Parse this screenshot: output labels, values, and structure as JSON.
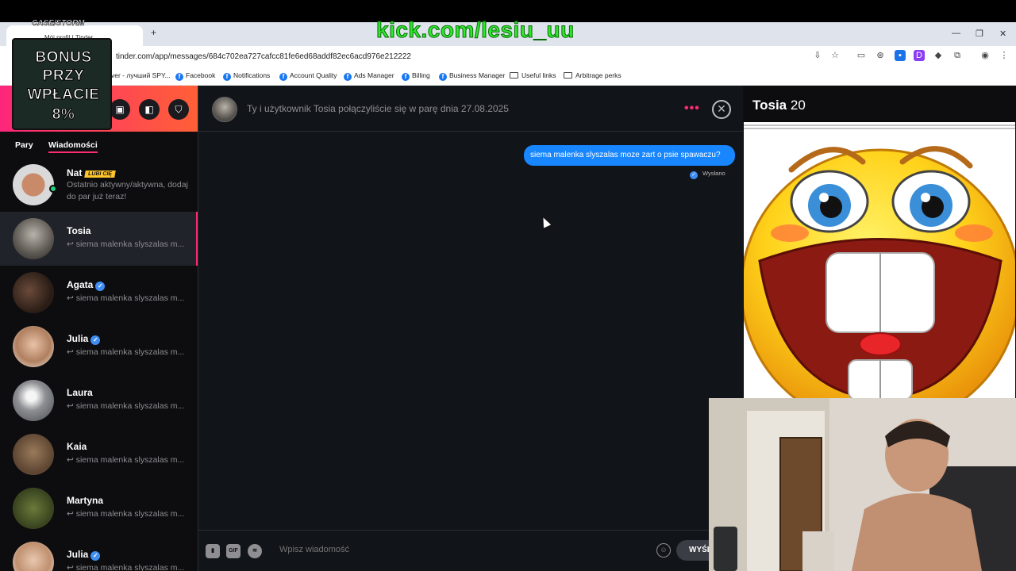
{
  "overlay": {
    "stream_url": "kick.com/lesiu_uu",
    "promo_logo": "CASE/STORM",
    "promo_line1": "BONUS",
    "promo_line2": "PRZY",
    "promo_line3": "WPŁACIE",
    "promo_line4": "8%"
  },
  "browser": {
    "tab_title": "Mój profil | Tinder",
    "new_tab": "+",
    "url": "tinder.com/app/messages/684c702ea727cafcc81fe6ed68addf82ec6acd976e212222",
    "bookmarks": [
      {
        "label": "ver - лучший SPY...",
        "icon": "none"
      },
      {
        "label": "Facebook",
        "icon": "facebook-icon"
      },
      {
        "label": "Notifications",
        "icon": "facebook-icon"
      },
      {
        "label": "Account Quality",
        "icon": "facebook-icon"
      },
      {
        "label": "Ads Manager",
        "icon": "facebook-icon"
      },
      {
        "label": "Billing",
        "icon": "facebook-icon"
      },
      {
        "label": "Business Manager",
        "icon": "facebook-icon"
      },
      {
        "label": "Useful links",
        "icon": "folder-icon"
      },
      {
        "label": "Arbitrage perks",
        "icon": "folder-icon"
      }
    ]
  },
  "sidebar": {
    "tabs": {
      "matches": "Pary",
      "messages": "Wiadomości"
    },
    "conversations": [
      {
        "name": "Nat",
        "badge": "LUBI CIĘ",
        "verified": false,
        "preview": "Ostatnio aktywny/aktywna, dodaj do par już teraz!",
        "online": true
      },
      {
        "name": "Tosia",
        "verified": false,
        "preview": "↩ siema malenka slyszalas m...",
        "selected": true
      },
      {
        "name": "Agata",
        "verified": true,
        "preview": "↩ siema malenka slyszalas m..."
      },
      {
        "name": "Julia",
        "verified": true,
        "preview": "↩ siema malenka slyszalas m..."
      },
      {
        "name": "Laura",
        "verified": false,
        "preview": "↩ siema malenka slyszalas m..."
      },
      {
        "name": "Kaia",
        "verified": false,
        "preview": "↩ siema malenka slyszalas m..."
      },
      {
        "name": "Martyna",
        "verified": false,
        "preview": "↩ siema malenka slyszalas m..."
      },
      {
        "name": "Julia",
        "verified": true,
        "preview": "↩ siema malenka slyszalas m..."
      }
    ]
  },
  "chat": {
    "match_text": "Ty i użytkownik Tosia połączyliście się w parę dnia 27.08.2025",
    "message": "siema malenka slyszalas moze zart o psie spawaczu?",
    "status": "Wysłano",
    "input_placeholder": "Wpisz wiadomość",
    "gif_label": "GIF",
    "send_label": "WYŚLIJ"
  },
  "profile": {
    "name": "Tosia",
    "age": "20"
  },
  "colors": {
    "brand": "#fd2c6f",
    "bubble": "#1786ff",
    "stream_text": "#2ee82b"
  }
}
